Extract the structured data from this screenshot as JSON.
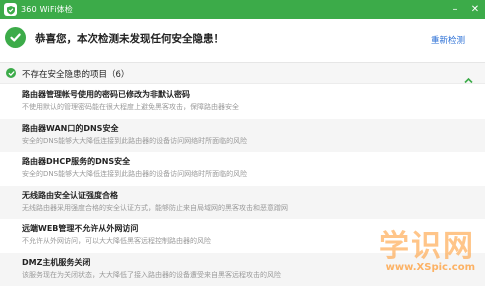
{
  "window": {
    "title": "360 WiFi体检",
    "minimize_glyph": "–",
    "close_glyph": "✕",
    "accent_color": "#3cab49"
  },
  "header": {
    "message": "恭喜您，本次检测未发现任何安全隐患！",
    "rescan_label": "重新检测",
    "icon": "check-circle-icon"
  },
  "group": {
    "title": "不存在安全隐患的项目（6）",
    "collapse_icon": "chevron-up-icon"
  },
  "items": [
    {
      "title": "路由器管理帐号使用的密码已修改为非默认密码",
      "desc": "不使用默认的管理密码能在很大程度上避免黑客攻击，保障路由器安全"
    },
    {
      "title": "路由器WAN口的DNS安全",
      "desc": "安全的DNS能够大大降低连接到此路由器的设备访问网络时所面临的风险"
    },
    {
      "title": "路由器DHCP服务的DNS安全",
      "desc": "安全的DNS能够大大降低连接到此路由器的设备访问网络时所面临的风险"
    },
    {
      "title": "无线路由安全认证强度合格",
      "desc": "无线路由器采用强度合格的安全认证方式，能够防止来自局域网的黑客攻击和恶意蹭网"
    },
    {
      "title": "远端WEB管理不允许从外网访问",
      "desc": "不允许从外网访问，可以大大降低黑客远程控制路由器的风险"
    },
    {
      "title": "DMZ主机服务关闭",
      "desc": "该服务现在为关闭状态，大大降低了接入路由器的设备遭受来自黑客远程攻击的风险"
    }
  ],
  "watermark": {
    "big": "学识网",
    "url": "www.XSpic.com"
  }
}
